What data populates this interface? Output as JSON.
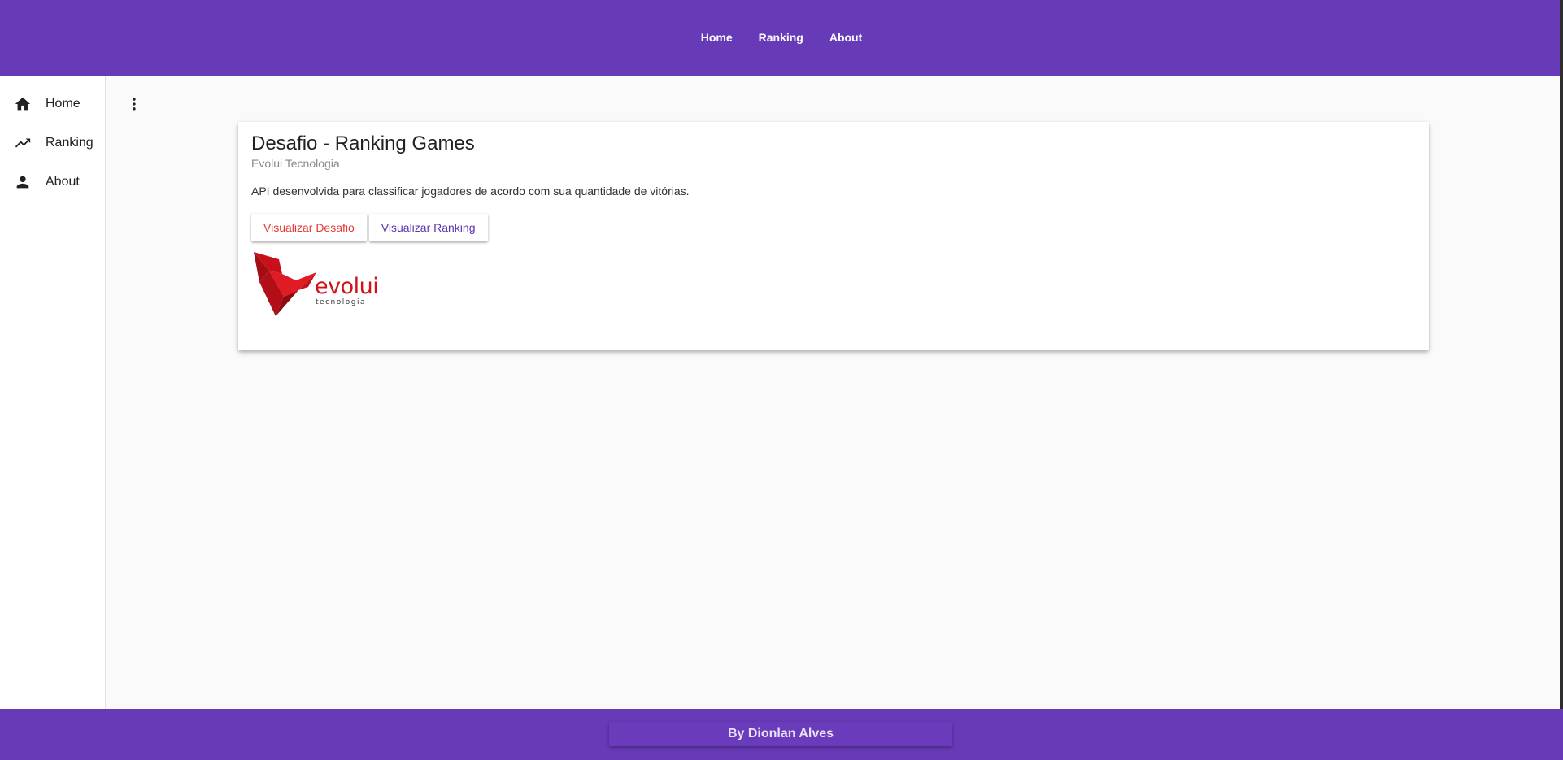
{
  "topnav": {
    "items": [
      {
        "label": "Home"
      },
      {
        "label": "Ranking"
      },
      {
        "label": "About"
      }
    ]
  },
  "sidebar": {
    "items": [
      {
        "label": "Home",
        "icon": "home-icon"
      },
      {
        "label": "Ranking",
        "icon": "trending-up-icon"
      },
      {
        "label": "About",
        "icon": "person-icon"
      }
    ]
  },
  "main": {
    "more_icon": "more-vert-icon"
  },
  "card": {
    "title": "Desafio - Ranking Games",
    "subtitle": "Evolui Tecnologia",
    "description": "API desenvolvida para classificar jogadores de acordo com sua quantidade de vitórias.",
    "buttons": {
      "desafio": "Visualizar Desafio",
      "ranking": "Visualizar Ranking"
    },
    "logo": {
      "word": "evolui",
      "sub": "tecnologia"
    }
  },
  "footer": {
    "text": "By Dionlan Alves"
  },
  "colors": {
    "primary": "#673ab7",
    "accent_red": "#e53935",
    "accent_purple": "#5e35b1",
    "logo_red": "#d0121b"
  }
}
